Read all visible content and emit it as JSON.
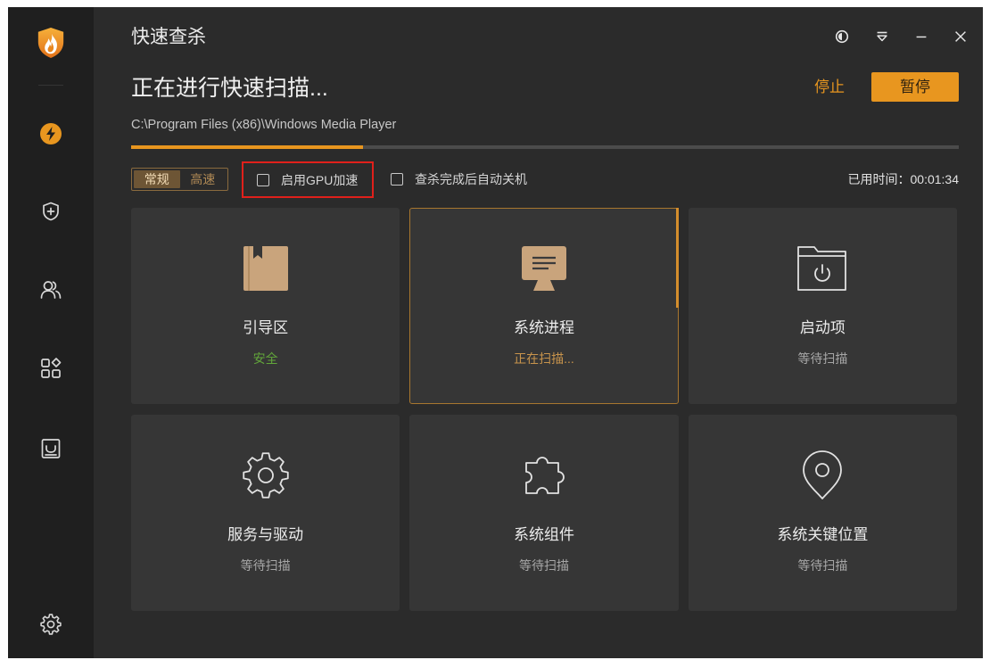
{
  "window": {
    "title": "快速查杀"
  },
  "scan": {
    "heading": "正在进行快速扫描...",
    "current_path": "C:\\Program Files (x86)\\Windows Media Player",
    "progress": 0.28,
    "elapsed_label": "已用时间：",
    "elapsed": "00:01:34"
  },
  "actions": {
    "stop_label": "停止",
    "pause_label": "暂停"
  },
  "mode": {
    "options": [
      {
        "label": "常规",
        "selected": true
      },
      {
        "label": "高速",
        "selected": false
      }
    ]
  },
  "options": {
    "gpu": {
      "label": "启用GPU加速",
      "checked": false
    },
    "auto_shutdown": {
      "label": "查杀完成后自动关机",
      "checked": false
    }
  },
  "cards": [
    {
      "label": "引导区",
      "status": "安全",
      "status_kind": "safe",
      "icon": "book-icon",
      "active": false
    },
    {
      "label": "系统进程",
      "status": "正在扫描...",
      "status_kind": "scanning",
      "icon": "monitor-icon",
      "active": true
    },
    {
      "label": "启动项",
      "status": "等待扫描",
      "status_kind": "waiting",
      "icon": "folder-power-icon",
      "active": false
    },
    {
      "label": "服务与驱动",
      "status": "等待扫描",
      "status_kind": "waiting",
      "icon": "gear-icon",
      "active": false
    },
    {
      "label": "系统组件",
      "status": "等待扫描",
      "status_kind": "waiting",
      "icon": "puzzle-icon",
      "active": false
    },
    {
      "label": "系统关键位置",
      "status": "等待扫描",
      "status_kind": "waiting",
      "icon": "location-pin-icon",
      "active": false
    }
  ],
  "sidebar": {
    "items": [
      "logo-icon",
      "lightning-icon",
      "shield-plus-icon",
      "users-icon",
      "apps-icon",
      "inbox-icon",
      "settings-icon"
    ]
  },
  "title_bar": {
    "controls": [
      "theme-icon",
      "menu-icon",
      "minimize-icon",
      "close-icon"
    ]
  },
  "colors": {
    "accent": "#e8961f",
    "safe": "#62a63a",
    "scanning": "#c8944c",
    "waiting": "#a6a6a6",
    "highlight": "#e0201b",
    "sidebar_bg": "#1f1f1f",
    "main_bg": "#2b2b2b",
    "card_bg": "#363636"
  }
}
